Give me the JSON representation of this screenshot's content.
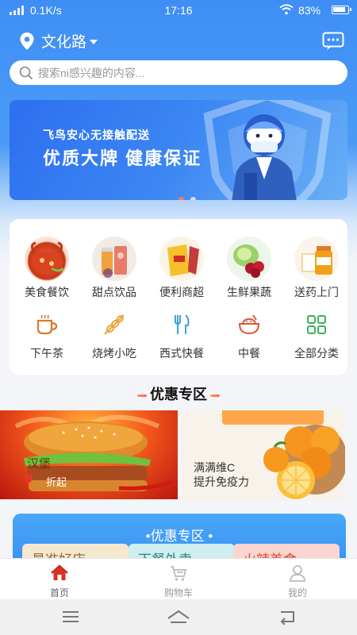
{
  "status_bar": {
    "network_speed": "0.1K/s",
    "time": "17:16",
    "battery": "83%"
  },
  "header": {
    "location": "文化路",
    "location_icon": "location-pin-icon",
    "message_icon": "chat-bubble-icon"
  },
  "search": {
    "placeholder": "搜索ni感兴趣的内容..."
  },
  "banner": {
    "subtitle": "飞鸟安心无接触配送",
    "title": "优质大牌  健康保证",
    "slide_count": 2,
    "active_slide": 1
  },
  "categories_top": [
    {
      "label": "美食餐饮",
      "icon": "lobster-food-icon"
    },
    {
      "label": "甜点饮品",
      "icon": "drinks-icon"
    },
    {
      "label": "便利商超",
      "icon": "snacks-icon"
    },
    {
      "label": "生鲜果蔬",
      "icon": "vegetables-icon"
    },
    {
      "label": "送药上门",
      "icon": "medicine-icon"
    }
  ],
  "categories_bottom": [
    {
      "label": "下午茶",
      "icon": "coffee-cup-icon"
    },
    {
      "label": "烧烤小吃",
      "icon": "skewer-icon"
    },
    {
      "label": "西式快餐",
      "icon": "fork-knife-icon"
    },
    {
      "label": "中餐",
      "icon": "rice-bowl-icon"
    },
    {
      "label": "全部分类",
      "icon": "grid-icon"
    }
  ],
  "promo": {
    "heading": "优惠专区",
    "left": {
      "title": "汉堡",
      "badge": "9",
      "sub": "折起"
    },
    "right": {
      "line1": "满满维C",
      "line2": "提升免疫力"
    }
  },
  "blue_card": {
    "title": "•优惠专区 •",
    "chips": [
      {
        "label": "最准好店",
        "color": "#f6e7cf",
        "text_color": "#8a6a3a"
      },
      {
        "label": "下餐外卖",
        "color": "#cfeef0",
        "text_color": "#2d7f86"
      },
      {
        "label": "火辣美食",
        "color": "#fbd6d0",
        "text_color": "#d94c3a"
      }
    ]
  },
  "tabbar": [
    {
      "label": "首页",
      "icon": "home-icon",
      "active": true
    },
    {
      "label": "购物车",
      "icon": "cart-icon",
      "active": false
    },
    {
      "label": "我的",
      "icon": "profile-icon",
      "active": false
    }
  ],
  "navbar": {
    "menu_icon": "menu-icon",
    "home_icon": "home-nav-icon",
    "back_icon": "back-icon"
  }
}
